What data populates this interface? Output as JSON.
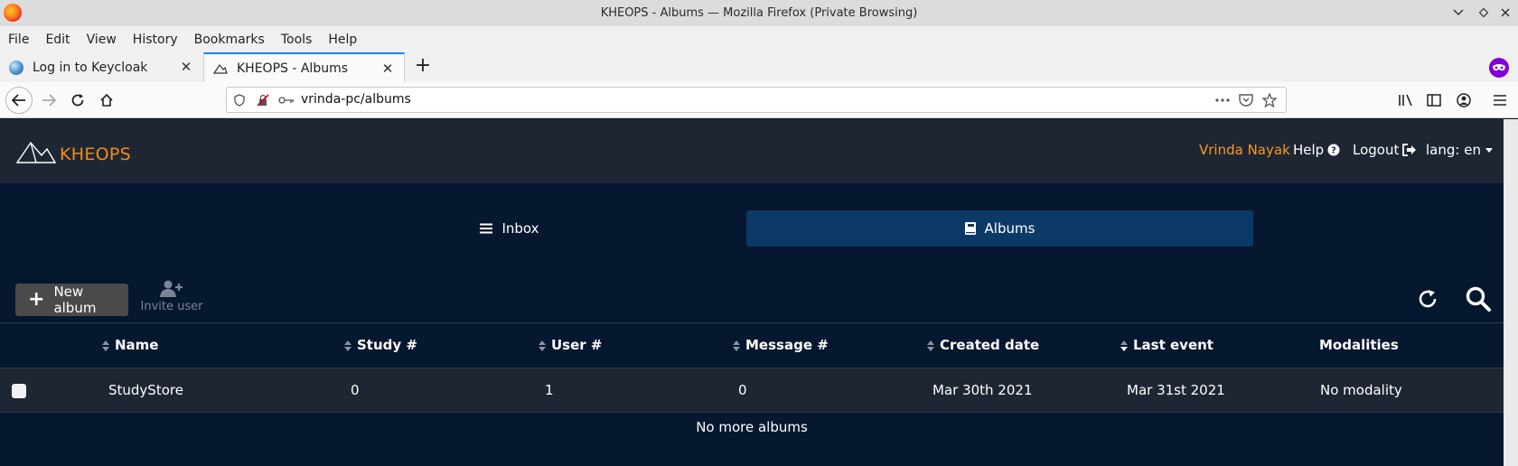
{
  "window": {
    "title": "KHEOPS - Albums — Mozilla Firefox (Private Browsing)"
  },
  "menu": {
    "items": [
      "File",
      "Edit",
      "View",
      "History",
      "Bookmarks",
      "Tools",
      "Help"
    ]
  },
  "tabs": [
    {
      "title": "Log in to Keycloak",
      "active": false
    },
    {
      "title": "KHEOPS - Albums",
      "active": true
    }
  ],
  "url": "vrinda-pc/albums",
  "header": {
    "app_name": "KHEOPS",
    "user_name": "Vrinda Nayak",
    "help_label": "Help",
    "logout_label": "Logout",
    "lang_label": "lang: en"
  },
  "nav": {
    "inbox_label": "Inbox",
    "albums_label": "Albums"
  },
  "toolbar": {
    "new_album_label": "New album",
    "invite_user_label": "Invite user"
  },
  "table": {
    "columns": [
      "Name",
      "Study #",
      "User #",
      "Message #",
      "Created date",
      "Last event",
      "Modalities"
    ],
    "rows": [
      {
        "name": "StudyStore",
        "study": "0",
        "user": "1",
        "message": "0",
        "created": "Mar 30th 2021",
        "last_event": "Mar 31st 2021",
        "modalities": "No modality"
      }
    ],
    "footer": "No more albums"
  },
  "colors": {
    "background": "#061730",
    "header": "#1f2633",
    "accent": "#f08c1a",
    "active_tab": "#0b3a66"
  }
}
